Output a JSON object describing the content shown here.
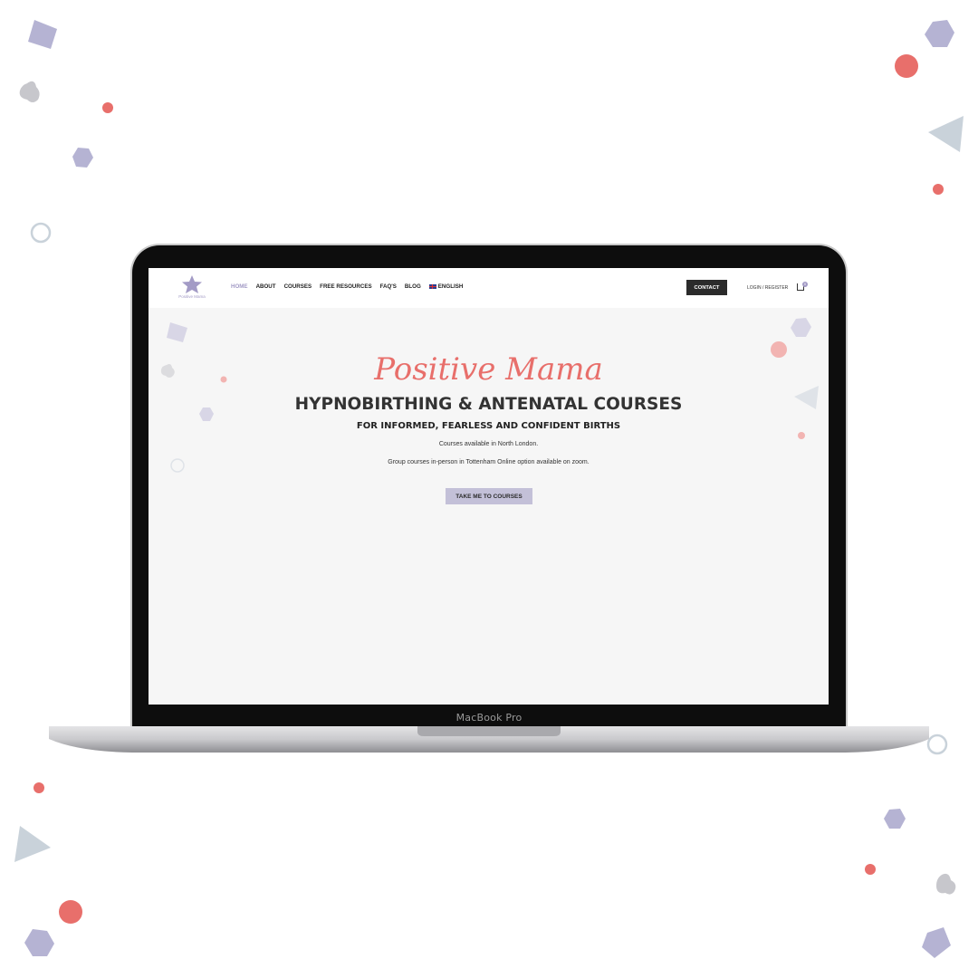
{
  "device": {
    "label": "MacBook Pro"
  },
  "site": {
    "logo_text": "Positive Mama",
    "nav": [
      "HOME",
      "ABOUT",
      "COURSES",
      "FREE RESOURCES",
      "FAQ'S",
      "BLOG"
    ],
    "language": "ENGLISH",
    "contact_label": "CONTACT",
    "login_label": "LOGIN / REGISTER",
    "cart_count": "0"
  },
  "hero": {
    "brand": "Positive Mama",
    "heading": "HYPNOBIRTHING & ANTENATAL COURSES",
    "subheading": "FOR INFORMED, FEARLESS AND CONFIDENT BIRTHS",
    "line1": "Courses available in North London.",
    "line2": "Group courses in-person in Tottenham Online option available on zoom.",
    "cta_label": "TAKE ME TO COURSES"
  },
  "colors": {
    "accent": "#e86f6b",
    "lavender": "#a39bc6",
    "cta_bg": "#c3c0d8",
    "dark": "#2b2b2b"
  },
  "icons": [
    "star-logo-icon",
    "uk-flag-icon",
    "cart-icon"
  ]
}
